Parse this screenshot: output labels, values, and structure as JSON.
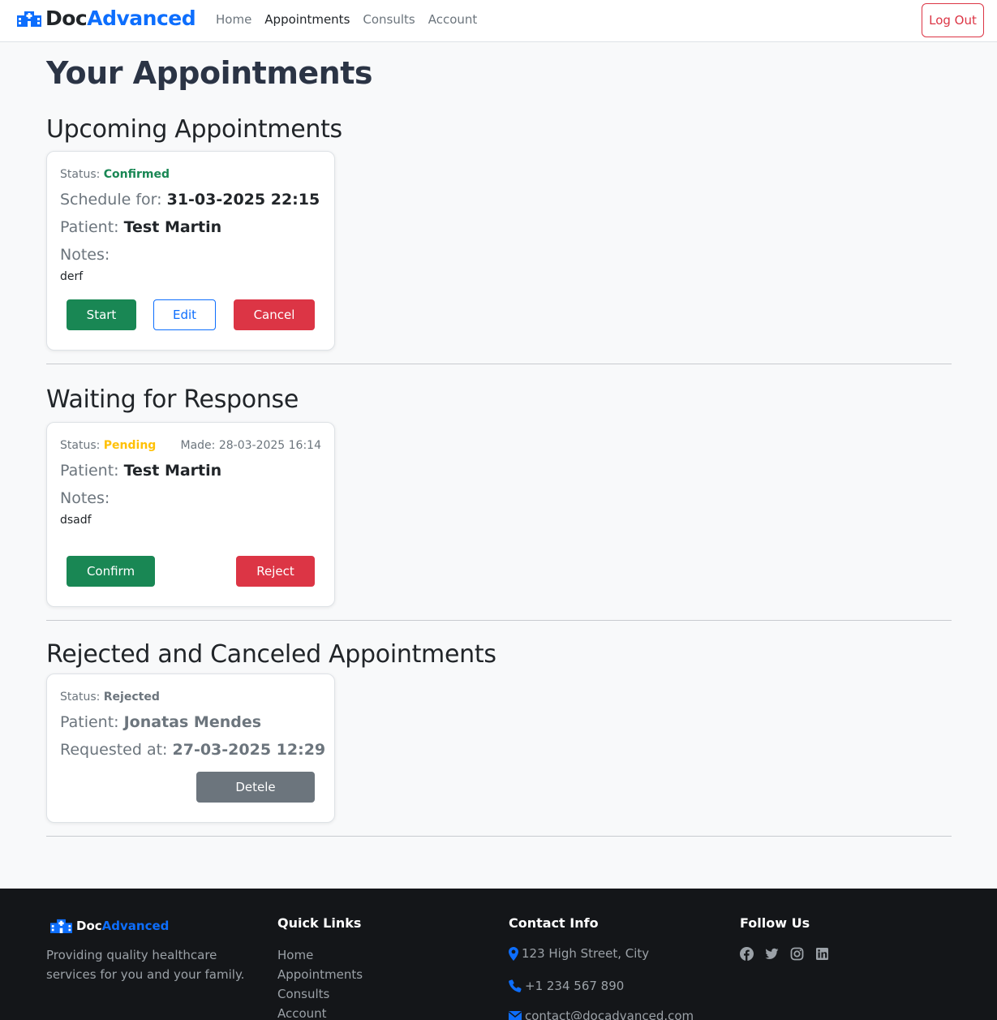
{
  "nav": {
    "brand_doc": "Doc",
    "brand_adv": "Advanced",
    "links": [
      "Home",
      "Appointments",
      "Consults",
      "Account"
    ],
    "active": "Appointments",
    "logout": "Log Out"
  },
  "page": {
    "title": "Your Appointments"
  },
  "upcoming": {
    "title": "Upcoming Appointments",
    "status_label": "Status:",
    "status": "Confirmed",
    "schedule_label": "Schedule for:",
    "schedule": "31-03-2025 22:15",
    "patient_label": "Patient:",
    "patient": "Test Martin",
    "notes_label": "Notes:",
    "notes": "derf",
    "start": "Start",
    "edit": "Edit",
    "cancel": "Cancel"
  },
  "waiting": {
    "title": "Waiting for Response",
    "status_label": "Status:",
    "status": "Pending",
    "made": "Made: 28-03-2025 16:14",
    "patient_label": "Patient:",
    "patient": "Test Martin",
    "notes_label": "Notes:",
    "notes": "dsadf",
    "confirm": "Confirm",
    "reject": "Reject"
  },
  "rejected": {
    "title": "Rejected and Canceled Appointments",
    "status_label": "Status:",
    "status": "Rejected",
    "patient_label": "Patient:",
    "patient": "Jonatas Mendes",
    "requested_label": "Requested at:",
    "requested": "27-03-2025 12:29",
    "delete": "Detele"
  },
  "footer": {
    "brand_doc": "Doc",
    "brand_adv": "Advanced",
    "description": "Providing quality healthcare services for you and your family.",
    "quick_links_title": "Quick Links",
    "quick_links": [
      "Home",
      "Appointments",
      "Consults",
      "Account"
    ],
    "contact_title": "Contact Info",
    "address": "123 High Street, City",
    "phone": "+1 234 567 890",
    "email": "contact@docadvanced.com",
    "follow_title": "Follow Us",
    "social_icons": [
      "facebook-icon",
      "twitter-icon",
      "instagram-icon",
      "linkedin-icon"
    ]
  },
  "colors": {
    "primary": "#0d6efd",
    "success": "#198754",
    "danger": "#dc3545",
    "warning": "#ffc107",
    "secondary": "#6c757d"
  }
}
